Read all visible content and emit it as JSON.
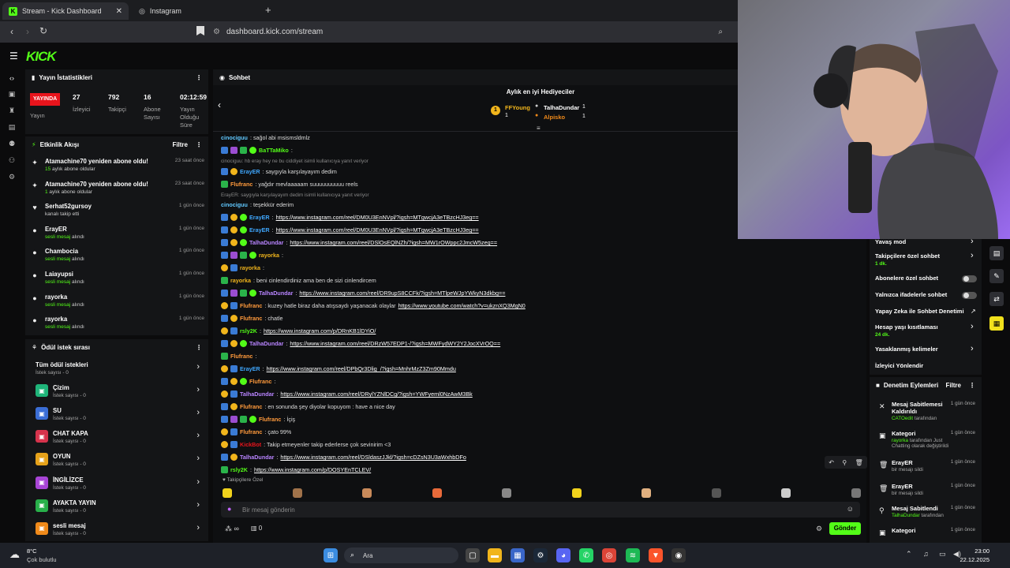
{
  "browser": {
    "tabs": [
      {
        "title": "Stream - Kick Dashboard"
      },
      {
        "title": "Instagram"
      }
    ],
    "url": "dashboard.kick.com/stream"
  },
  "logo": "KICK",
  "stats": {
    "title": "Yayın İstatistikleri",
    "live_badge": "YAYINDA",
    "live_label": "Yayın",
    "viewers_value": "27",
    "viewers_label": "İzleyici",
    "followers_value": "792",
    "followers_label": "Takipçi",
    "subs_value": "16",
    "subs_label": "Abone Sayısı",
    "duration_value": "02:12:59",
    "duration_label": "Yayın Olduğu Süre"
  },
  "activity": {
    "title": "Etkinlik Akışı",
    "filter": "Filtre",
    "events": [
      {
        "icon": "star-icon",
        "name": "Atamachine70 yeniden abone oldu!",
        "sub_accent": "15",
        "sub": " aylık abone oldular",
        "time": "23 saat önce"
      },
      {
        "icon": "star-icon",
        "name": "Atamachine70 yeniden abone oldu!",
        "sub_accent": "1",
        "sub": " aylık abone oldular",
        "time": "23 saat önce"
      },
      {
        "icon": "heart-icon",
        "name": "Serhat52gursoy",
        "sub_accent": "",
        "sub": "kanalı takip etti",
        "time": "1 gün önce"
      },
      {
        "icon": "person-icon",
        "name": "ErayER",
        "sub_accent": "sesli mesaj",
        "sub": " alındı",
        "time": "1 gün önce"
      },
      {
        "icon": "person-icon",
        "name": "Chambocia",
        "sub_accent": "sesli mesaj",
        "sub": " alındı",
        "time": "1 gün önce"
      },
      {
        "icon": "person-icon",
        "name": "Laiayupsi",
        "sub_accent": "sesli mesaj",
        "sub": " alındı",
        "time": "1 gün önce"
      },
      {
        "icon": "person-icon",
        "name": "rayorka",
        "sub_accent": "sesli mesaj",
        "sub": " alındı",
        "time": "1 gün önce"
      },
      {
        "icon": "person-icon",
        "name": "rayorka",
        "sub_accent": "sesli mesaj",
        "sub": " alındı",
        "time": "1 gün önce"
      }
    ]
  },
  "rewards": {
    "title": "Ödül istek sırası",
    "items": [
      {
        "name": "Tüm ödül istekleri",
        "sub": "İstek sayısı - 0",
        "color": ""
      },
      {
        "name": "Çizim",
        "sub": "İstek sayısı - 0",
        "color": "#1fb57a"
      },
      {
        "name": "SU",
        "sub": "İstek sayısı - 0",
        "color": "#3b6ed6"
      },
      {
        "name": "CHAT KAPA",
        "sub": "İstek sayısı - 0",
        "color": "#d6334c"
      },
      {
        "name": "OYUN",
        "sub": "İstek sayısı - 0",
        "color": "#e6a21a"
      },
      {
        "name": "İNGİLİZCE",
        "sub": "İstek sayısı - 0",
        "color": "#a845d6"
      },
      {
        "name": "AYAKTA YAYIN",
        "sub": "İstek sayısı - 0",
        "color": "#28b04a"
      },
      {
        "name": "sesli mesaj",
        "sub": "İstek sayısı - 0",
        "color": "#f08a1a"
      }
    ]
  },
  "chat": {
    "title": "Sohbet",
    "gifters_title": "Aylık en iyi Hediyeciler",
    "gifters": [
      {
        "name": "FFYoung",
        "count": "1"
      },
      {
        "name": "TalhaDundar",
        "count": "1"
      },
      {
        "name": "Alpisko",
        "count": "1"
      }
    ],
    "messages": [
      {
        "user": "cinociguu",
        "color": "#60c8ff",
        "text": ": sağol abi msismsldmlz",
        "link": ""
      },
      {
        "user": "BaTTaMiko",
        "color": "#53fc18",
        "text": ":",
        "link": ""
      },
      {
        "reply": "cinociguu: hb eray hey ne bu ciddiyet isimli kullanıcıya yanıt veriyor"
      },
      {
        "user": "ErayER",
        "color": "#3fa8ff",
        "text": ": saygıyla karşılayayım dedim",
        "link": ""
      },
      {
        "user": "Flufranc",
        "color": "#ff9a3c",
        "text": ": yağdır mevlaaaaam suuuuuuuuuu reels",
        "link": ""
      },
      {
        "reply": "ErayER: saygıyla karşılayayım dedim isimli kullanıcıya yanıt veriyor"
      },
      {
        "user": "cinociguu",
        "color": "#60c8ff",
        "text": ": teşekkür ederim",
        "link": ""
      },
      {
        "user": "ErayER",
        "color": "#3fa8ff",
        "text": ":",
        "link": "https://www.instagram.com/reel/DM0U3EnNVpl/?igsh=MTgwcjA3eTBzcHJ3eg=="
      },
      {
        "user": "ErayER",
        "color": "#3fa8ff",
        "text": ":",
        "link": "https://www.instagram.com/reel/DM0U3EnNVpl/?igsh=MTgwcjA3eTBzcHJ3eg=="
      },
      {
        "user": "TalhaDundar",
        "color": "#b884ff",
        "text": ":",
        "link": "https://www.instagram.com/reel/DSlOsEQlNZh/?igsh=MW1rOWppc2JmcW5zeg=="
      },
      {
        "user": "rayorka",
        "color": "#f1b51c",
        "text": ":",
        "link": ""
      },
      {
        "user": "rayorka",
        "color": "#f1b51c",
        "text": ":",
        "link": ""
      },
      {
        "user": "rayorka",
        "color": "#f1b51c",
        "text": ": beni cinlendirdiniz ama ben de sizi cinlendircem",
        "link": ""
      },
      {
        "user": "TalhaDundar",
        "color": "#b884ff",
        "text": ":",
        "link": "https://www.instagram.com/reel/DR9upS8CCFk/?igsh=MTlpeWJpYWkyN3dkbg=="
      },
      {
        "user": "Flufranc",
        "color": "#ff9a3c",
        "text": ": kuzey hatle biraz daha atışsaydı yaşanacak olaylar",
        "link": "https://www.youtube.com/watch?v=ukznXQ3MgN0"
      },
      {
        "user": "Flufranc",
        "color": "#ff9a3c",
        "text": ": chatle",
        "link": ""
      },
      {
        "user": "rsly2K",
        "color": "#53fc18",
        "text": ":",
        "link": "https://www.instagram.com/p/DRnKB1lDYiO/"
      },
      {
        "user": "TalhaDundar",
        "color": "#b884ff",
        "text": ":",
        "link": "https://www.instagram.com/reel/DRzW57EDP1-/?igsh=MWFydWY2Y2JocXVrOQ=="
      },
      {
        "user": "Flufranc",
        "color": "#ff9a3c",
        "text": ":",
        "link": ""
      },
      {
        "user": "ErayER",
        "color": "#3fa8ff",
        "text": ":",
        "link": "https://www.instagram.com/reel/DPbQr3Dlig_/?igsh=MnhrMzZ3Zm90Mmdu"
      },
      {
        "user": "Flufranc",
        "color": "#ff9a3c",
        "text": ":",
        "link": ""
      },
      {
        "user": "TalhaDundar",
        "color": "#b884ff",
        "text": ":",
        "link": "https://www.instagram.com/reel/DRylYZNlDCg/?igsh=YWFyeml0NzAwM3Bk"
      },
      {
        "user": "Flufranc",
        "color": "#ff9a3c",
        "text": ": en sonunda şey diyolar kopuyom : have a nice day",
        "link": ""
      },
      {
        "user": "Flufranc",
        "color": "#ff9a3c",
        "text": ": İçiş",
        "link": ""
      },
      {
        "user": "Flufranc",
        "color": "#ff9a3c",
        "text": ": çato 99%",
        "link": ""
      },
      {
        "user": "KickBot",
        "color": "#e8141c",
        "text": ": Takip etmeyenler takip ederlerse çok sevinirim <3",
        "link": ""
      },
      {
        "user": "TalhaDundar",
        "color": "#b884ff",
        "text": ":",
        "link": "https://www.instagram.com/reel/DSldaszJJkl/?igsh=cDZsN3U3aWxhbDFo"
      },
      {
        "user": "rsly2K",
        "color": "#53fc18",
        "text": ":",
        "link": "https://www.instagram.com/p/DOSYEnTCLEV/"
      }
    ],
    "emote_label": "Takipçilere Özel",
    "input_placeholder": "Bir mesaj gönderin",
    "points": "∞",
    "gift_count": "0",
    "send": "Gönder"
  },
  "settings": {
    "items": [
      {
        "label": "Yavaş mod",
        "sub": "",
        "control": "chevron"
      },
      {
        "label": "Takipçilere özel sohbet",
        "sub": "1 dk.",
        "control": "chevron"
      },
      {
        "label": "Abonelere özel sohbet",
        "sub": "",
        "control": "toggle"
      },
      {
        "label": "Yalnızca ifadelerle sohbet",
        "sub": "",
        "control": "toggle"
      },
      {
        "label": "Yapay Zeka ile Sohbet Denetimi",
        "sub": "",
        "control": "external"
      },
      {
        "label": "Hesap yaşı kısıtlaması",
        "sub": "24 dk.",
        "control": "chevron"
      },
      {
        "label": "Yasaklanmış kelimeler",
        "sub": "",
        "control": "chevron"
      },
      {
        "label": "İzleyici Yönlendir",
        "sub": "",
        "control": "none"
      }
    ]
  },
  "modlog": {
    "title": "Denetim Eylemleri",
    "filter": "Filtre",
    "items": [
      {
        "icon": "pin-off-icon",
        "title": "Mesaj Sabitlemesi Kaldırıldı",
        "accent": "CATOedit",
        "sub": " tarafından",
        "time": "1 gün önce"
      },
      {
        "icon": "category-icon",
        "title": "Kategori",
        "accent": "rayorka",
        "sub": " tarafından Just Chatting olarak değiştirildi",
        "time": "1 gün önce"
      },
      {
        "icon": "trash-icon",
        "title": "ErayER",
        "accent": "",
        "sub": "bir mesajı sildi",
        "time": "1 gün önce"
      },
      {
        "icon": "trash-icon",
        "title": "ErayER",
        "accent": "",
        "sub": "bir mesajı sildi",
        "time": "1 gün önce"
      },
      {
        "icon": "pin-icon",
        "title": "Mesaj Sabitlendi",
        "accent": "TalhaDundar",
        "sub": " tarafından",
        "time": "1 gün önce"
      },
      {
        "icon": "category-icon",
        "title": "Kategori",
        "accent": "",
        "sub": "",
        "time": "1 gün önce"
      }
    ]
  },
  "taskbar": {
    "weather_temp": "8°C",
    "weather_desc": "Çok bulutlu",
    "search": "Ara",
    "time": "23:00",
    "date": "22.12.2025"
  }
}
